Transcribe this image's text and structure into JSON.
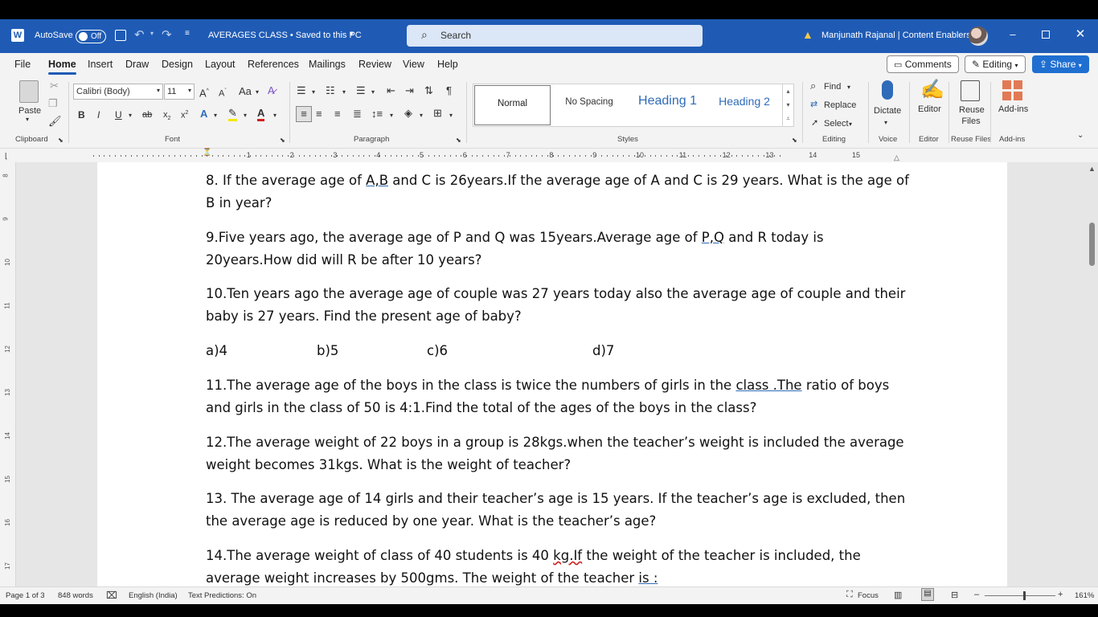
{
  "titlebar": {
    "autosave_label": "AutoSave",
    "autosave_state": "Off",
    "doc_title": "AVERAGES CLASS • Saved to this PC",
    "search_placeholder": "Search",
    "user_name": "Manjunath Rajanal | Content Enablers",
    "accent": "#1f5bb5"
  },
  "tabs": [
    "File",
    "Home",
    "Insert",
    "Draw",
    "Design",
    "Layout",
    "References",
    "Mailings",
    "Review",
    "View",
    "Help"
  ],
  "tab_actions": {
    "comments": "Comments",
    "editing": "Editing",
    "share": "Share"
  },
  "ribbon": {
    "clipboard": {
      "paste": "Paste",
      "group": "Clipboard"
    },
    "font": {
      "name": "Calibri (Body)",
      "size": "11",
      "group": "Font"
    },
    "paragraph": {
      "group": "Paragraph"
    },
    "styles": {
      "items": [
        "Normal",
        "No Spacing",
        "Heading 1",
        "Heading 2"
      ],
      "group": "Styles"
    },
    "editing": {
      "find": "Find",
      "replace": "Replace",
      "select": "Select",
      "group": "Editing"
    },
    "voice": {
      "dictate": "Dictate",
      "group": "Voice"
    },
    "editor": {
      "label": "Editor",
      "group": "Editor"
    },
    "reuse": {
      "label": "Reuse Files",
      "group": "Reuse Files"
    },
    "addins": {
      "label": "Add-ins",
      "group": "Add-ins"
    }
  },
  "ruler_numbers": [
    "1",
    "2",
    "3",
    "4",
    "5",
    "6",
    "7",
    "8",
    "9",
    "10",
    "11",
    "12",
    "13",
    "14",
    "15"
  ],
  "vruler_numbers": [
    "8",
    "9",
    "10",
    "11",
    "12",
    "13",
    "14",
    "15",
    "16",
    "17"
  ],
  "document": {
    "q8": "8. If the average age of A,B and C is 26years.If the average age of A and C is 29 years. What is the age of B in year?",
    "q9": "9.Five years ago, the average age of P and Q was 15years.Average age of P,Q and R today is 20years.How did will R be after 10 years?",
    "q10": "10.Ten years ago the average age of couple was 27 years today also the average age of couple and their baby is 27 years. Find the present age of baby?",
    "q10_options": [
      "a)4",
      "b)5",
      "c)6",
      "d)7"
    ],
    "q11": "11.The average age of the boys in the class is twice the numbers of girls in the class .The ratio of boys and girls in the class of 50 is 4:1.Find the total of the ages of the boys in the class?",
    "q12": "12.The average weight of 22 boys in a group is 28kgs.when the teacher’s weight is included the average weight becomes 31kgs. What is the weight of teacher?",
    "q13": "13. The average age of 14 girls and their teacher’s age is 15 years. If the teacher’s age is excluded, then the average age is reduced by one year. What is the teacher’s age?",
    "q14": "14.The average weight of class of 40 students is 40 kg.If the weight of the teacher is included, the average weight increases by 500gms. The weight of the teacher is :"
  },
  "status": {
    "page": "Page 1 of 3",
    "words": "848 words",
    "language": "English (India)",
    "text_predictions": "Text Predictions: On",
    "focus": "Focus",
    "zoom": "161%"
  }
}
